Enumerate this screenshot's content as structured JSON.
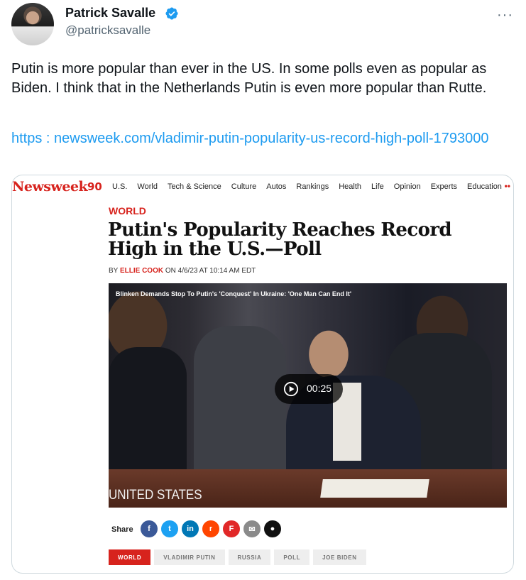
{
  "author": {
    "name": "Patrick Savalle",
    "handle": "@patricksavalle",
    "verified": true
  },
  "more_label": "···",
  "tweet": {
    "text": "Putin is more popular than ever in the US. In some polls even as popular as Biden. I think that in the Netherlands Putin is even more popular than Rutte.",
    "link": "https : newsweek.com/vladimir-putin-popularity-us-record-high-poll-1793000"
  },
  "card": {
    "logo": "Newsweek",
    "logo_badge": "90",
    "nav": [
      "U.S.",
      "World",
      "Tech & Science",
      "Culture",
      "Autos",
      "Rankings",
      "Health",
      "Life",
      "Opinion",
      "Experts",
      "Education"
    ],
    "nav_more": "••",
    "section": "WORLD",
    "headline": "Putin's Popularity Reaches Record High in the U.S.—Poll",
    "byline_prefix": "BY",
    "byline_author": "ELLIE COOK",
    "byline_date": "ON 4/6/23 AT 10:14 AM EDT",
    "video": {
      "title": "Blinken Demands Stop To Putin's 'Conquest' In Ukraine: 'One Man Can End It'",
      "duration": "00:25",
      "sign_text": "UNITED STATES"
    },
    "share_label": "Share",
    "share_icons": [
      {
        "name": "facebook",
        "glyph": "f",
        "color": "#3b5998"
      },
      {
        "name": "twitter",
        "glyph": "t",
        "color": "#1da1f2"
      },
      {
        "name": "linkedin",
        "glyph": "in",
        "color": "#0077b5"
      },
      {
        "name": "reddit",
        "glyph": "r",
        "color": "#ff4500"
      },
      {
        "name": "flipboard",
        "glyph": "F",
        "color": "#e12828"
      },
      {
        "name": "email",
        "glyph": "✉",
        "color": "#8a8a8a"
      },
      {
        "name": "comment",
        "glyph": "●",
        "color": "#111111"
      }
    ],
    "tags": [
      "WORLD",
      "VLADIMIR PUTIN",
      "RUSSIA",
      "POLL",
      "JOE BIDEN"
    ]
  }
}
